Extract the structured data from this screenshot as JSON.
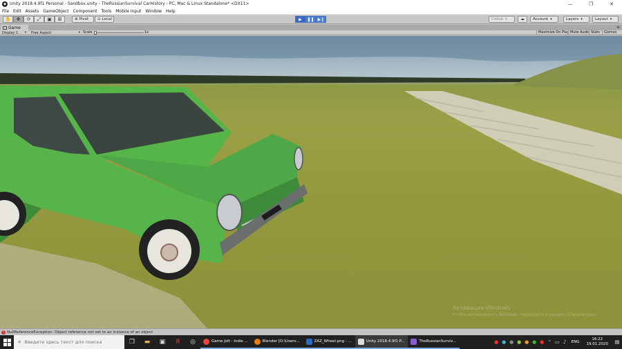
{
  "window": {
    "title": "Unity 2018.4.9f1 Personal - Sandbox.unity - TheRussianSurvival CarHistory - PC, Mac & Linux Standalone* <DX11>",
    "minimize": "—",
    "maximize": "❐",
    "close": "✕"
  },
  "menu": [
    "File",
    "Edit",
    "Assets",
    "GameObject",
    "Component",
    "Tools",
    "Mobile Input",
    "Window",
    "Help"
  ],
  "toolbar": {
    "pivot_label": "Pivot",
    "local_label": "Local",
    "collab_label": "Collab",
    "account_label": "Account",
    "layers_label": "Layers",
    "layout_label": "Layout",
    "play_icon": "▶",
    "pause_icon": "❚❚",
    "step_icon": "▶❙"
  },
  "game_tab": {
    "label": "Game",
    "menu_glyph": "≡"
  },
  "game_controls": {
    "display": "Display 1",
    "aspect": "Free Aspect",
    "scale_label": "Scale",
    "scale_value": "1x",
    "maximize_on_play": "Maximize On Play",
    "mute_audio": "Mute Audio",
    "stats": "Stats",
    "gizmos": "Gizmos"
  },
  "watermark": {
    "line1": "Активация Windows",
    "line2": "Чтобы активировать Windows, перейдите в раздел «Параметры»."
  },
  "console": {
    "message": "NullReferenceException: Object reference not set to an instance of an object"
  },
  "taskbar": {
    "search_placeholder": "Введите здесь текст для поиска",
    "apps": [
      {
        "label": "Game Jolt - Indie ...",
        "color": "#e8453c"
      },
      {
        "label": "Blender [D:\\Users...",
        "color": "#e87d0d"
      },
      {
        "label": "ZAZ_Wheel.png - ...",
        "color": "#2b6cc4"
      },
      {
        "label": "Unity 2018.4.9f1 P...",
        "color": "#dddddd"
      },
      {
        "label": "TheRussianSurviv...",
        "color": "#8a5cd0"
      }
    ],
    "lang": "ENG",
    "time": "16:22",
    "date": "19.01.2020"
  }
}
